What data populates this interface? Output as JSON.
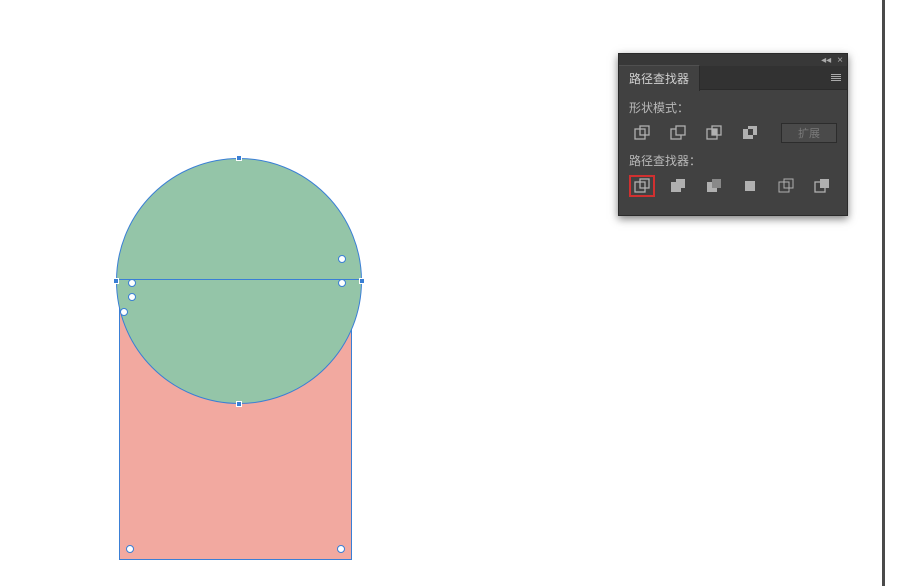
{
  "panel": {
    "title": "路径查找器",
    "section_shape_modes": "形状模式：",
    "section_pathfinders": "路径查找器：",
    "expand_label": "扩展",
    "shape_modes": [
      {
        "name": "unite-icon"
      },
      {
        "name": "minus-front-icon"
      },
      {
        "name": "intersect-icon"
      },
      {
        "name": "exclude-icon"
      }
    ],
    "pathfinders": [
      {
        "name": "divide-icon",
        "highlighted": true
      },
      {
        "name": "trim-icon"
      },
      {
        "name": "merge-icon"
      },
      {
        "name": "crop-icon"
      },
      {
        "name": "outline-icon"
      },
      {
        "name": "minus-back-icon"
      }
    ]
  },
  "canvas": {
    "circle": {
      "fill": "#94c5a8"
    },
    "rect": {
      "fill": "#f2a9a0"
    }
  }
}
